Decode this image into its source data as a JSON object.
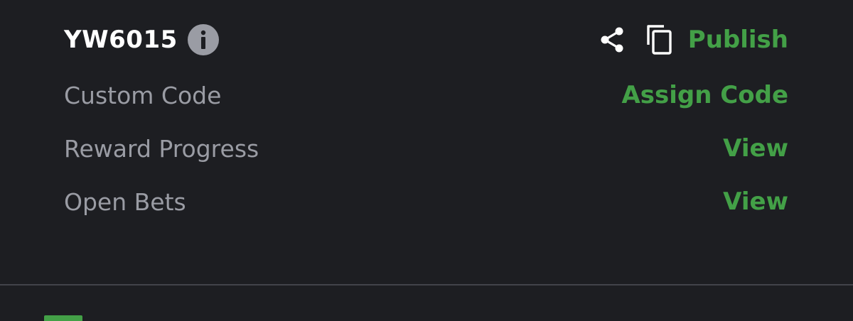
{
  "header": {
    "booking_code": "YW6015",
    "info_icon": "info-circle-icon",
    "share_icon": "share-icon",
    "copy_icon": "copy-icon",
    "publish_label": "Publish"
  },
  "rows": [
    {
      "label": "Custom Code",
      "action": "Assign Code"
    },
    {
      "label": "Reward Progress",
      "action": "View"
    },
    {
      "label": "Open Bets",
      "action": "View"
    }
  ],
  "colors": {
    "background": "#1d1e22",
    "accent_green": "#43a047",
    "label_gray": "#9a9ca4",
    "title_white": "#ffffff",
    "divider": "#42434a"
  }
}
